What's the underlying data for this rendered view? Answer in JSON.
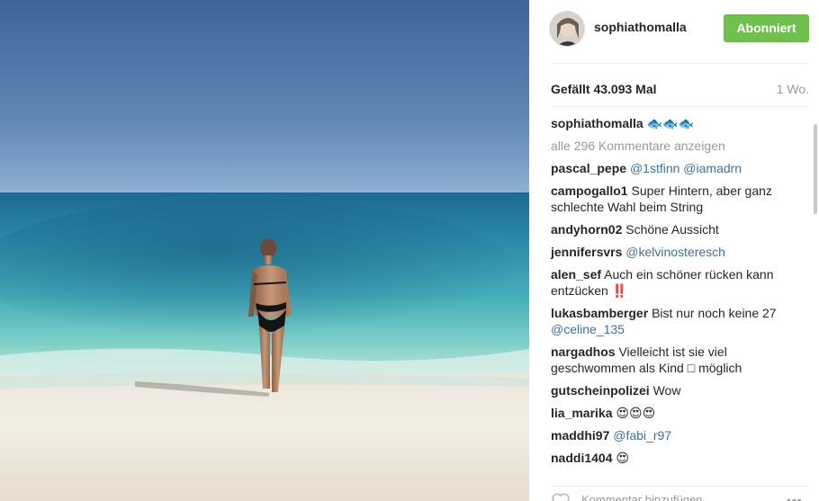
{
  "post": {
    "author": "sophiathomalla",
    "follow_label": "Abonniert",
    "likes": "Gefällt 43.093 Mal",
    "age": "1 Wo.",
    "caption_username": "sophiathomalla",
    "caption_text": "🐟🐟🐟",
    "view_all": "alle 296 Kommentare anzeigen"
  },
  "comments": [
    {
      "user": "pascal_pepe",
      "text": "",
      "mentions": "@1stfinn @iamadrn"
    },
    {
      "user": "campogallo1",
      "text": "Super Hintern, aber ganz schlechte Wahl beim String",
      "mentions": ""
    },
    {
      "user": "andyhorn02",
      "text": "Schöne Aussicht",
      "mentions": ""
    },
    {
      "user": "jennifersvrs",
      "text": "",
      "mentions": "@kelvinosteresch"
    },
    {
      "user": "alen_sef",
      "text": "Auch ein schöner rücken kann entzücken ‼️",
      "mentions": ""
    },
    {
      "user": "lukasbamberger",
      "text": "Bist nur noch keine 27",
      "mentions": "@celine_135"
    },
    {
      "user": "nargadhos",
      "text": "Vielleicht ist sie viel geschwommen als Kind □ möglich",
      "mentions": ""
    },
    {
      "user": "gutscheinpolizei",
      "text": "Wow",
      "mentions": ""
    },
    {
      "user": "lia_marika",
      "text": "😍😍😍",
      "mentions": ""
    },
    {
      "user": "maddhi97",
      "text": "",
      "mentions": "@fabi_r97"
    },
    {
      "user": "naddi1404",
      "text": "😍",
      "mentions": ""
    }
  ],
  "composer": {
    "placeholder": "Kommentar hinzufügen ...",
    "more_label": "•••"
  },
  "colors": {
    "follow_button": "#70c050",
    "mention": "#3f729b",
    "muted": "#999999"
  },
  "icons": {
    "like": "heart-outline-icon",
    "options": "more-options-icon"
  }
}
